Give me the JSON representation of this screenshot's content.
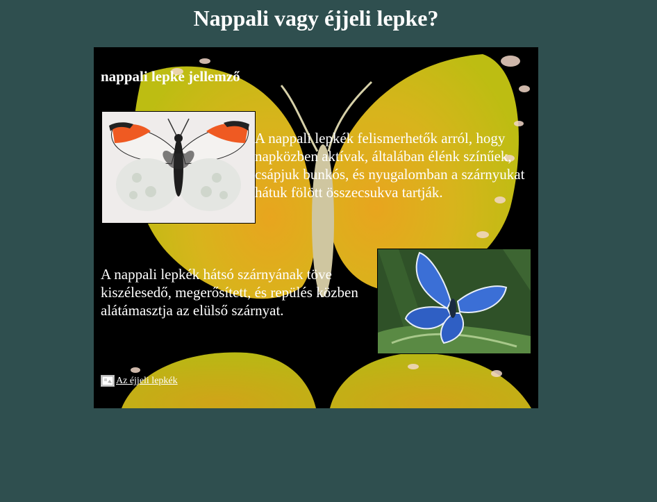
{
  "page": {
    "title": "Nappali vagy éjjeli lepke?"
  },
  "panel": {
    "heading": "nappali lepke jellemző",
    "paragraph_1": "A nappali lepkék felismerhetők arról, hogy napközben aktívak, általában élénk színűek, csápjuk bunkós, és nyugalomban a szárnyukat hátuk fölött összecsukva tartják.",
    "paragraph_2": "A nappali lepkék hátsó szárnyának töve kiszélesedő, megerősített, és repülés közben alátámasztja az elülső szárnyat.",
    "link_label": "Az éjjeli lepkék",
    "link_icon": "broken-image-icon"
  },
  "colors": {
    "page_background": "#2f4f4f",
    "panel_background": "#000000",
    "text": "#ffffff",
    "bg_butterfly_yellow": "#c8c418",
    "bg_butterfly_orange": "#e6a11c"
  }
}
